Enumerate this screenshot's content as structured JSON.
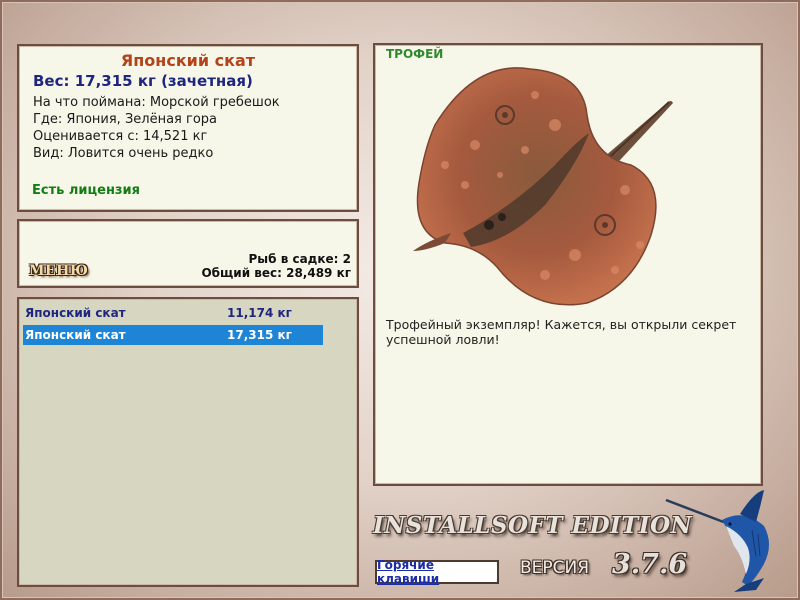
{
  "info": {
    "title": "Японский скат",
    "weight": "Вес: 17,315 кг (зачетная)",
    "bait": "На что поймана: Морской гребешок",
    "where": "Где: Япония, Зелёная гора",
    "estimate": "Оценивается с: 14,521 кг",
    "kind": "Вид: Ловится очень редко",
    "license": "Есть лицензия"
  },
  "keepnet": {
    "menu_label": "МЕНЮ",
    "count": "Рыб в садке: 2",
    "total_weight": "Общий вес: 28,489 кг"
  },
  "catch_list": [
    {
      "name": "Японский скат",
      "weight": "11,174 кг",
      "selected": false
    },
    {
      "name": "Японский скат",
      "weight": "17,315 кг",
      "selected": true
    }
  ],
  "trophy": {
    "label": "ТРОФЕЙ",
    "image_icon": "stingray-fish-image",
    "message": "Трофейный экземпляр! Кажется, вы открыли секрет успешной ловли!"
  },
  "footer": {
    "edition": "INSTALLSOFT EDITION",
    "hotkeys": "Горячие клавиши",
    "version_label": "ВЕРСИЯ",
    "version_number": "3.7.6",
    "logo_icon": "marlin-logo-icon"
  },
  "colors": {
    "selection": "#1e84d6",
    "title_red": "#b3431a",
    "weight_blue": "#1f2680",
    "license_green": "#137c14",
    "trophy_green": "#2f8a2d"
  }
}
